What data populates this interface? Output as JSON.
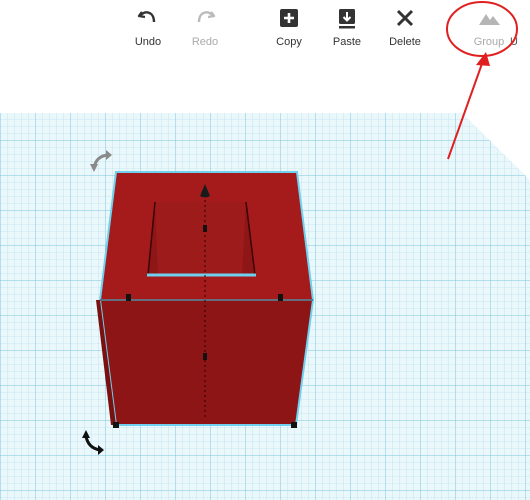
{
  "toolbar": {
    "undo_label": "Undo",
    "redo_label": "Redo",
    "copy_label": "Copy",
    "paste_label": "Paste",
    "delete_label": "Delete",
    "group_label": "Group",
    "ungroup_label_partial": "U"
  },
  "colors": {
    "grid_line": "#a9dbe8",
    "grid_bg": "#eaf7fb",
    "box_front": "#8e1515",
    "box_top": "#9c1a1a",
    "box_outline": "#6fd0ef",
    "annotation": "#e02020"
  }
}
